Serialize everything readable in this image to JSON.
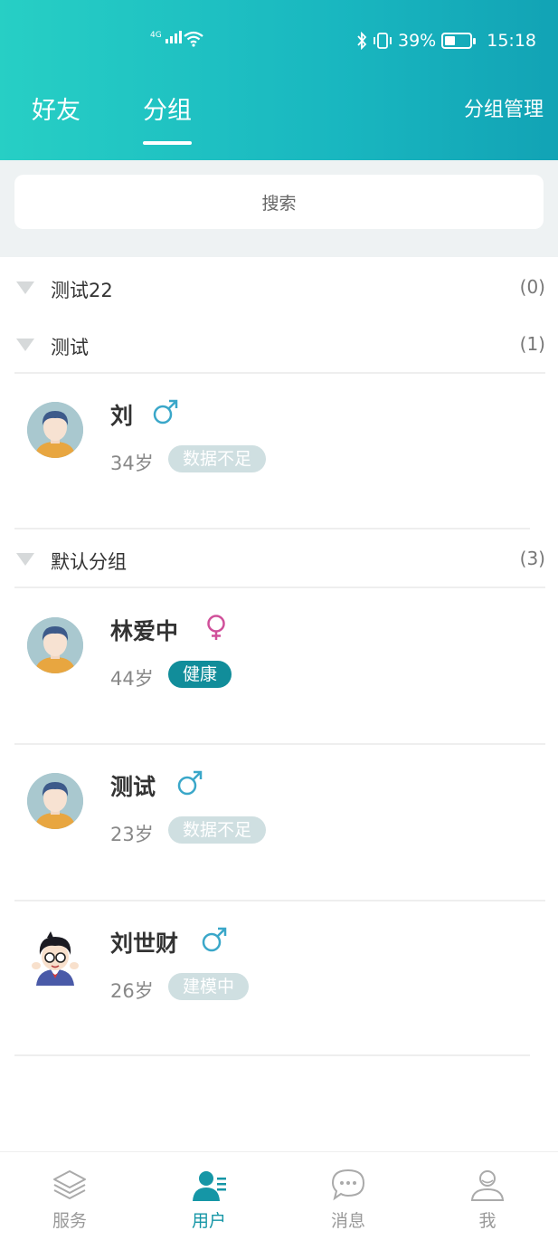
{
  "status_bar": {
    "network": "4G",
    "battery_percent": "39%",
    "time": "15:18"
  },
  "header": {
    "tabs": [
      {
        "label": "好友"
      },
      {
        "label": "分组"
      }
    ],
    "active_tab": "分组",
    "manage_label": "分组管理"
  },
  "search": {
    "placeholder": "搜索"
  },
  "groups": [
    {
      "name": "测试22",
      "count": "(0)",
      "members": []
    },
    {
      "name": "测试",
      "count": "(1)",
      "members": [
        {
          "name": "刘",
          "gender": "male",
          "age": "34岁",
          "status": "数据不足",
          "status_style": "gray"
        }
      ]
    },
    {
      "name": "默认分组",
      "count": "(3)",
      "members": [
        {
          "name": "林爱中",
          "gender": "female",
          "age": "44岁",
          "status": "健康",
          "status_style": "teal"
        },
        {
          "name": "测试",
          "gender": "male",
          "age": "23岁",
          "status": "数据不足",
          "status_style": "gray"
        },
        {
          "name": "刘世财",
          "gender": "male",
          "age": "26岁",
          "status": "建模中",
          "status_style": "gray"
        }
      ]
    }
  ],
  "bottom_nav": [
    {
      "label": "服务",
      "icon": "layers-icon"
    },
    {
      "label": "用户",
      "icon": "user-list-icon",
      "active": true
    },
    {
      "label": "消息",
      "icon": "chat-bubble-icon"
    },
    {
      "label": "我",
      "icon": "person-icon"
    }
  ],
  "colors": {
    "header_start": "#27cfc5",
    "header_end": "#12a3b5",
    "male": "#3aa7c9",
    "female": "#d0509a",
    "tag_teal": "#118d9a",
    "tag_gray": "#cfdfe1",
    "active_nav": "#1596a6"
  }
}
